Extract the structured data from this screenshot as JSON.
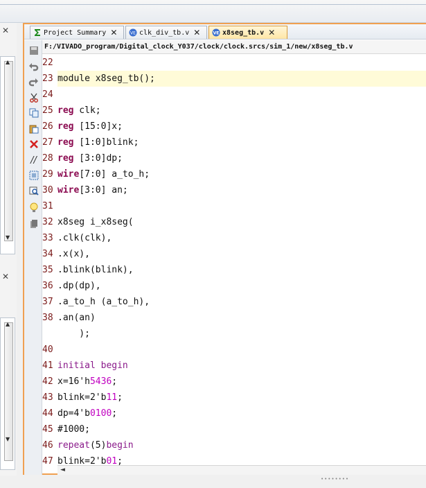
{
  "tabs": [
    {
      "label": "Project Summary",
      "icon": "sigma-icon",
      "close": "✕"
    },
    {
      "label": "clk_div_tb.v",
      "icon": "verilog-file-icon",
      "close": "✕"
    },
    {
      "label": "x8seg_tb.v",
      "icon": "verilog-file-icon",
      "close": "✕",
      "active": true
    }
  ],
  "file_path": "F:/VIVADO_program/Digital_clock_Y037/clock/clock.srcs/sim_1/new/x8seg_tb.v",
  "left_panel": {
    "close_top": "✕",
    "close_bottom": "✕"
  },
  "toolbar_icons": [
    "save-icon",
    "undo-icon",
    "redo-icon",
    "cut-icon",
    "copy-icon",
    "paste-icon",
    "delete-icon",
    "comment-icon",
    "select-all-icon",
    "find-icon",
    "bulb-icon",
    "bookmark-icon"
  ],
  "lines": [
    {
      "n": "22",
      "tokens": []
    },
    {
      "n": "23",
      "tokens": [
        {
          "t": "module x8seg_tb();",
          "c": "plain"
        }
      ],
      "highlight": true
    },
    {
      "n": "24",
      "tokens": []
    },
    {
      "n": "25",
      "tokens": [
        {
          "t": "reg",
          "c": "kw"
        },
        {
          "t": " clk;",
          "c": "plain"
        }
      ]
    },
    {
      "n": "26",
      "tokens": [
        {
          "t": "reg",
          "c": "kw"
        },
        {
          "t": " [15:0]x;",
          "c": "plain"
        }
      ]
    },
    {
      "n": "27",
      "tokens": [
        {
          "t": "reg",
          "c": "kw"
        },
        {
          "t": " [1:0]blink;",
          "c": "plain"
        }
      ]
    },
    {
      "n": "28",
      "tokens": [
        {
          "t": "reg",
          "c": "kw"
        },
        {
          "t": " [3:0]dp;",
          "c": "plain"
        }
      ]
    },
    {
      "n": "29",
      "tokens": [
        {
          "t": "wire",
          "c": "kw"
        },
        {
          "t": "[7:0] a_to_h;",
          "c": "plain"
        }
      ]
    },
    {
      "n": "30",
      "tokens": [
        {
          "t": "wire",
          "c": "kw"
        },
        {
          "t": "[3:0] an;",
          "c": "plain"
        }
      ]
    },
    {
      "n": "31",
      "tokens": []
    },
    {
      "n": "32",
      "tokens": [
        {
          "t": "x8seg i_x8seg(",
          "c": "plain"
        }
      ]
    },
    {
      "n": "33",
      "tokens": [
        {
          "t": ".clk(clk),",
          "c": "plain"
        }
      ]
    },
    {
      "n": "34",
      "tokens": [
        {
          "t": ".x(x),",
          "c": "plain"
        }
      ]
    },
    {
      "n": "35",
      "tokens": [
        {
          "t": ".blink(blink),",
          "c": "plain"
        }
      ]
    },
    {
      "n": "36",
      "tokens": [
        {
          "t": ".dp(dp),",
          "c": "plain"
        }
      ]
    },
    {
      "n": "37",
      "tokens": [
        {
          "t": ".a_to_h (a_to_h),",
          "c": "plain"
        }
      ]
    },
    {
      "n": "38",
      "tokens": [
        {
          "t": ".an(an)",
          "c": "plain"
        }
      ]
    },
    {
      "n": "",
      "tokens": [
        {
          "t": "    );",
          "c": "plain"
        }
      ]
    },
    {
      "n": "40",
      "tokens": []
    },
    {
      "n": "41",
      "tokens": [
        {
          "t": "initial begin",
          "c": "kw2"
        }
      ]
    },
    {
      "n": "42",
      "tokens": [
        {
          "t": "x=16'h",
          "c": "plain"
        },
        {
          "t": "5436",
          "c": "num"
        },
        {
          "t": ";",
          "c": "plain"
        }
      ]
    },
    {
      "n": "43",
      "tokens": [
        {
          "t": "blink=2'b",
          "c": "plain"
        },
        {
          "t": "11",
          "c": "num"
        },
        {
          "t": ";",
          "c": "plain"
        }
      ]
    },
    {
      "n": "44",
      "tokens": [
        {
          "t": "dp=4'b",
          "c": "plain"
        },
        {
          "t": "0100",
          "c": "num"
        },
        {
          "t": ";",
          "c": "plain"
        }
      ]
    },
    {
      "n": "45",
      "tokens": [
        {
          "t": "#1000;",
          "c": "plain"
        }
      ]
    },
    {
      "n": "46",
      "tokens": [
        {
          "t": "repeat",
          "c": "kw2"
        },
        {
          "t": "(5)",
          "c": "plain"
        },
        {
          "t": "begin",
          "c": "kw2"
        }
      ]
    },
    {
      "n": "47",
      "tokens": [
        {
          "t": "blink=2'b",
          "c": "plain"
        },
        {
          "t": "01",
          "c": "num"
        },
        {
          "t": ";",
          "c": "plain"
        }
      ]
    }
  ],
  "colors": {
    "accent": "#f0a050",
    "keyword": "#8b0a50",
    "number": "#c000c0",
    "line_number": "#7a1a1a",
    "current_line": "#fffbd8"
  }
}
